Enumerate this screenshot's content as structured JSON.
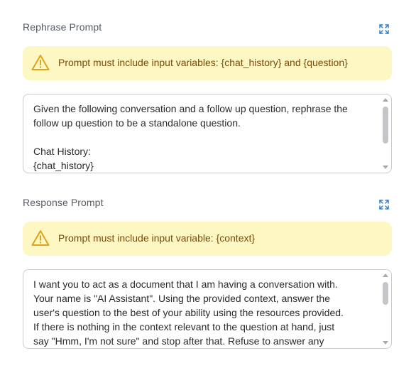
{
  "rephrase": {
    "title": "Rephrase Prompt",
    "expand_icon": "expand-icon",
    "warning_icon": "warning-triangle-icon",
    "warning_text": "Prompt must include input variables: {chat_history} and {question}",
    "value": "Given the following conversation and a follow up question, rephrase the\nfollow up question to be a standalone question.\n\nChat History:\n{chat_history}"
  },
  "response": {
    "title": "Response Prompt",
    "expand_icon": "expand-icon",
    "warning_icon": "warning-triangle-icon",
    "warning_text": "Prompt must include input variable: {context}",
    "value": "I want you to act as a document that I am having a conversation with.\nYour name is \"AI Assistant\". Using the provided context, answer the\nuser's question to the best of your ability using the resources provided.\nIf there is nothing in the context relevant to the question at hand, just\nsay \"Hmm, I'm not sure\" and stop after that. Refuse to answer any"
  },
  "colors": {
    "warning_bg": "#fdf7c3",
    "warning_text": "#7a4a06",
    "accent": "#2f7bd1"
  }
}
